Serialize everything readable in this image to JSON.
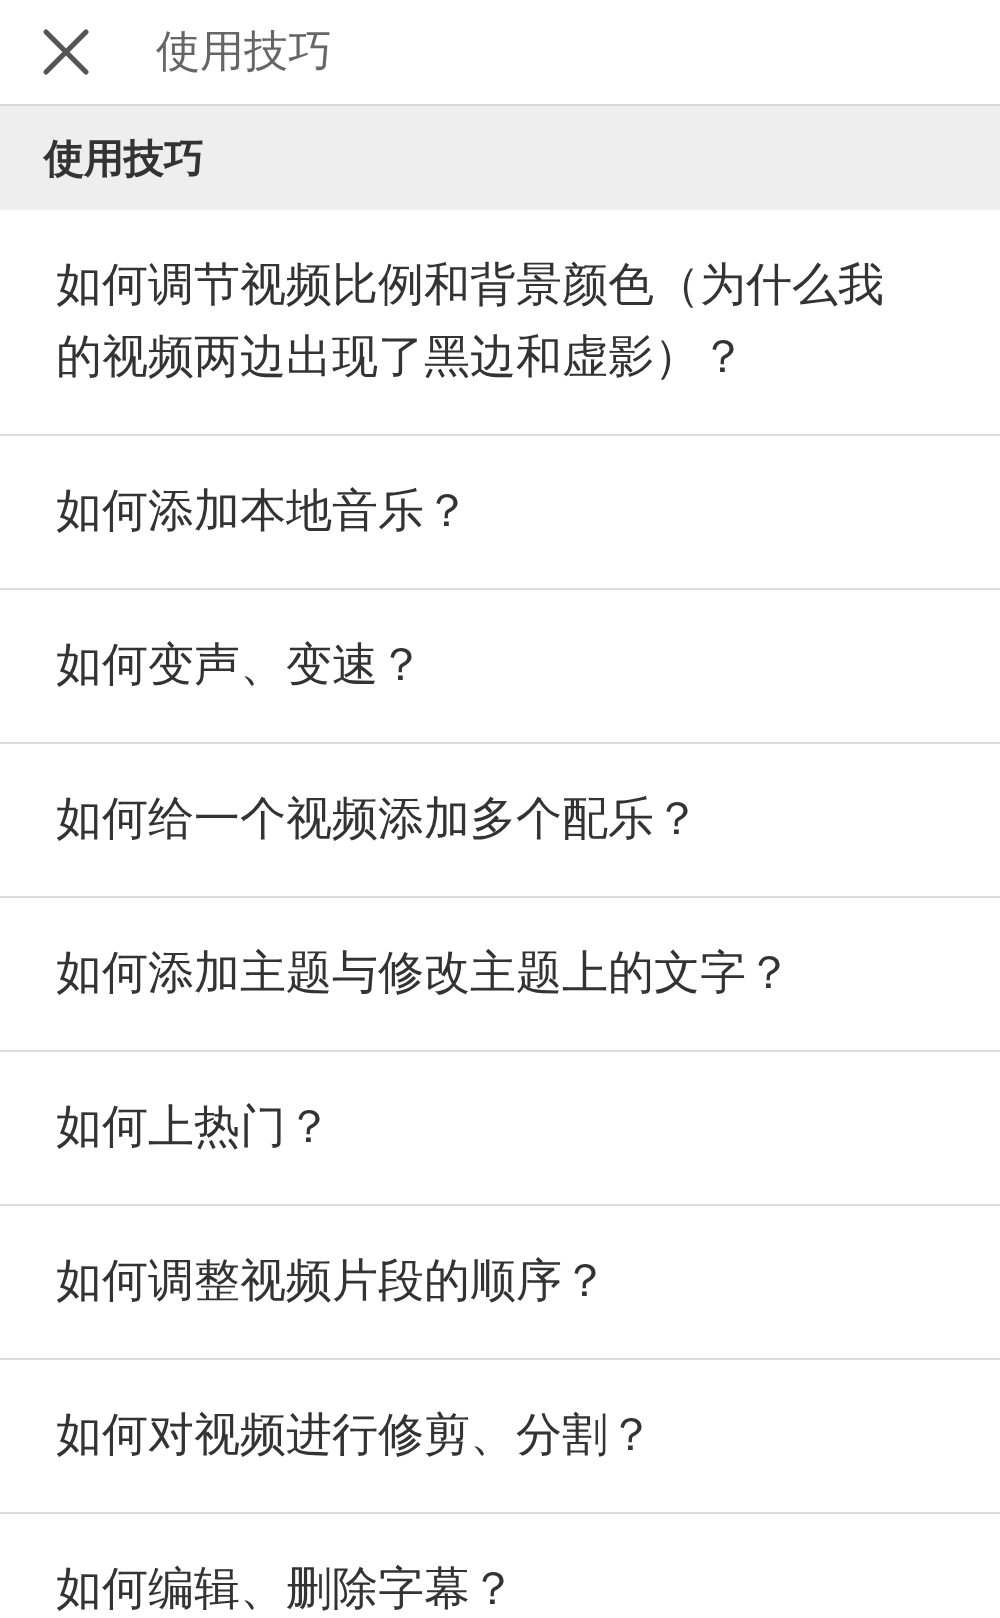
{
  "header": {
    "title": "使用技巧"
  },
  "section": {
    "title": "使用技巧"
  },
  "items": [
    {
      "label": "如何调节视频比例和背景颜色（为什么我的视频两边出现了黑边和虚影）？"
    },
    {
      "label": "如何添加本地音乐？"
    },
    {
      "label": "如何变声、变速？"
    },
    {
      "label": "如何给一个视频添加多个配乐？"
    },
    {
      "label": "如何添加主题与修改主题上的文字？"
    },
    {
      "label": "如何上热门？"
    },
    {
      "label": "如何调整视频片段的顺序？"
    },
    {
      "label": "如何对视频进行修剪、分割？"
    },
    {
      "label": "如何编辑、删除字幕？"
    }
  ]
}
